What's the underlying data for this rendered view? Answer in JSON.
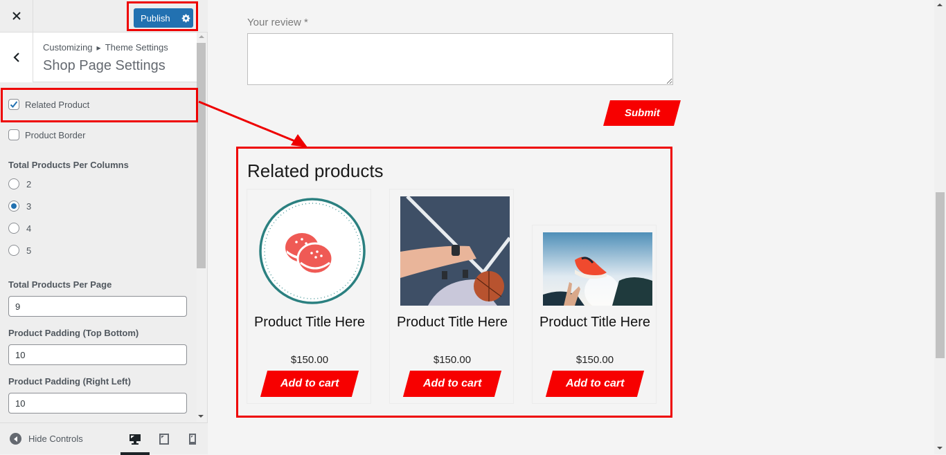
{
  "sidebar": {
    "close_icon": "close-icon",
    "publish_label": "Publish",
    "publish_settings_icon": "gear-icon",
    "back_icon": "chevron-left-icon",
    "breadcrumb": {
      "root": "Customizing",
      "separator_icon": "triangle-right-icon",
      "parent": "Theme Settings"
    },
    "section_title": "Shop Page Settings",
    "checkboxes": [
      {
        "label": "Related Product",
        "checked": true
      },
      {
        "label": "Product Border",
        "checked": false
      }
    ],
    "columns": {
      "label": "Total Products Per Columns",
      "options": [
        "2",
        "3",
        "4",
        "5"
      ],
      "selected": "3"
    },
    "fields": [
      {
        "label": "Total Products Per Page",
        "value": "9"
      },
      {
        "label": "Product Padding (Top Bottom)",
        "value": "10"
      },
      {
        "label": "Product Padding (Right Left)",
        "value": "10"
      }
    ],
    "footer": {
      "hide_controls_label": "Hide Controls",
      "devices": [
        "desktop",
        "tablet",
        "mobile"
      ],
      "active_device": "desktop"
    }
  },
  "preview": {
    "review_label": "Your review *",
    "review_value": "",
    "submit_label": "Submit",
    "related_title": "Related products",
    "products": [
      {
        "title": "Product Title Here",
        "price": "$150.00",
        "button": "Add to cart",
        "image": "macaron-badge-image"
      },
      {
        "title": "Product Title Here",
        "price": "$150.00",
        "button": "Add to cart",
        "image": "basketball-court-photo"
      },
      {
        "title": "Product Title Here",
        "price": "$150.00",
        "button": "Add to cart",
        "image": "flying-sneaker-photo"
      }
    ]
  },
  "colors": {
    "accent_blue": "#2271b1",
    "button_red": "#f70000",
    "annotation_red": "#ee0000"
  }
}
